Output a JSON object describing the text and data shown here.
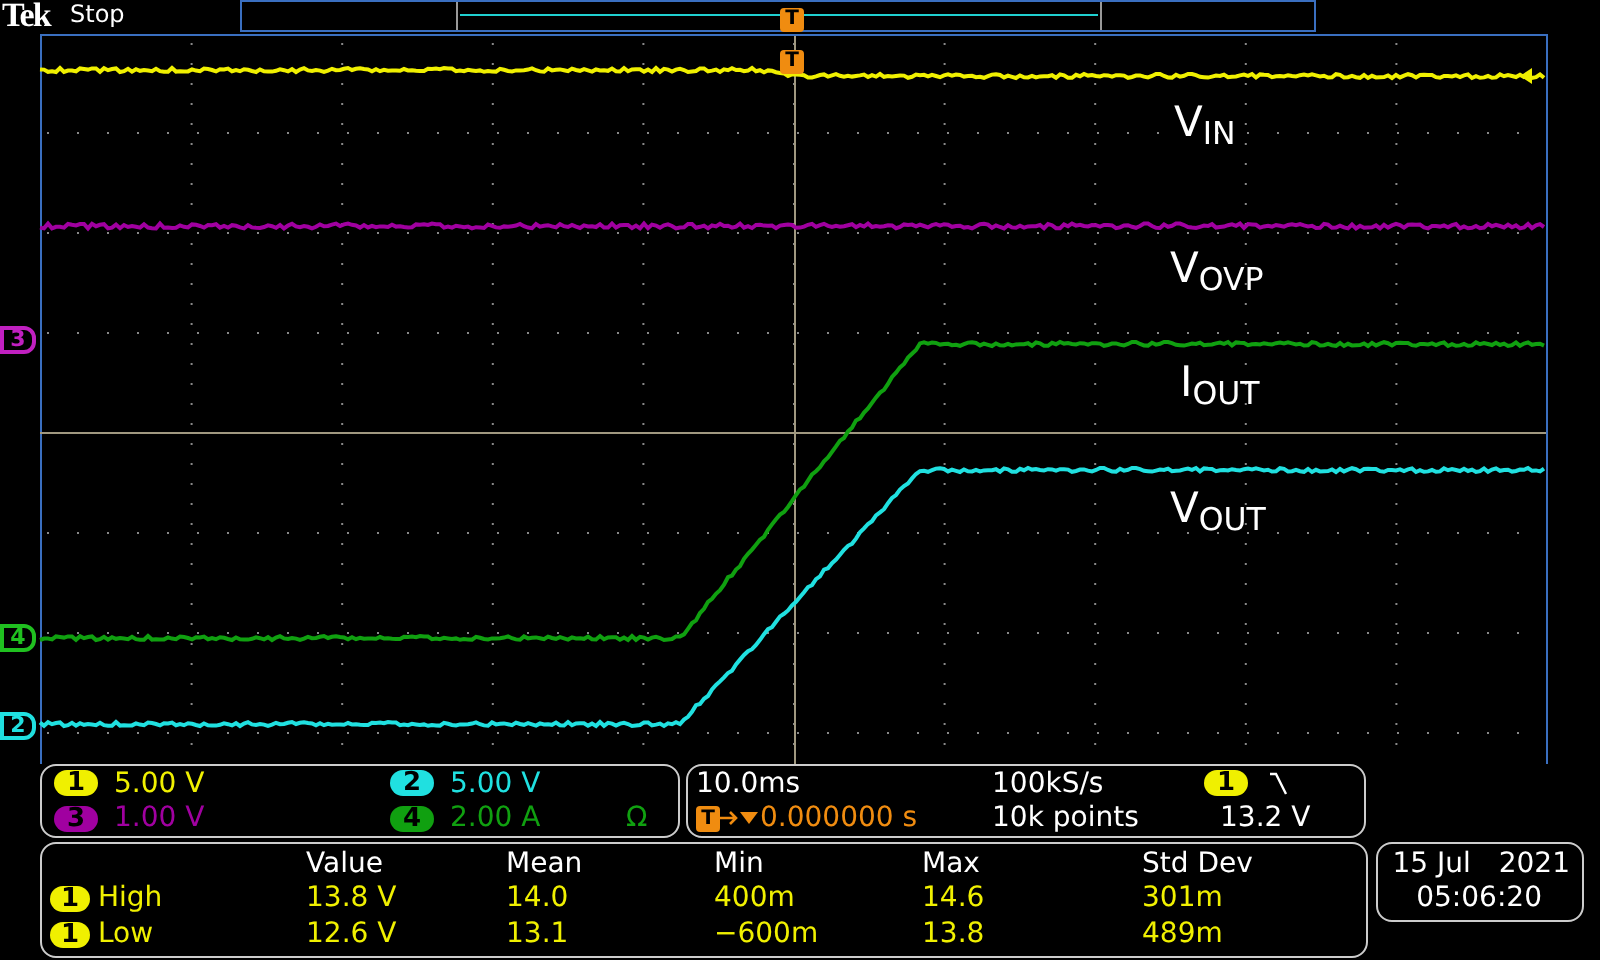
{
  "brand": "Tek",
  "acquisition_status": "Stop",
  "record_view": {
    "trigger_marker": "T"
  },
  "graticule": {
    "trigger_marker": "T"
  },
  "left_markers": [
    {
      "label": "3",
      "color": "#c020c0"
    },
    {
      "label": "4",
      "color": "#20c020"
    },
    {
      "label": "2",
      "color": "#20e0e0"
    }
  ],
  "trace_labels": [
    "V$_{IN}$",
    "V$_{OVP}$",
    "I$_{OUT}$",
    "V$_{OUT}$"
  ],
  "channels": [
    {
      "number": "1",
      "scale": "5.00 V",
      "color": "#f0f000"
    },
    {
      "number": "2",
      "scale": "5.00 V",
      "color": "#20e0e0"
    },
    {
      "number": "3",
      "scale": "1.00 V",
      "color": "#a000a0"
    },
    {
      "number": "4",
      "scale": "2.00 A",
      "termination": "Ω",
      "color": "#10a010"
    }
  ],
  "horizontal": {
    "time_scale": "10.0ms",
    "trigger_marker": "T",
    "trigger_position": "0.000000 s",
    "sample_rate": "100kS/s",
    "record_length": "10k points",
    "trigger_source": {
      "label": "1",
      "color": "#f0f000"
    },
    "trigger_level": "13.2 V"
  },
  "measurements": {
    "columns": [
      "Value",
      "Mean",
      "Min",
      "Max",
      "Std Dev"
    ],
    "rows": [
      {
        "source": "1",
        "color": "#f0f000",
        "name": "High",
        "values": [
          "13.8 V",
          "14.0",
          "400m",
          "14.6",
          "301m"
        ]
      },
      {
        "source": "1",
        "color": "#f0f000",
        "name": "Low",
        "values": [
          "12.6 V",
          "13.1",
          "−600m",
          "13.8",
          "489m"
        ]
      }
    ]
  },
  "date": {
    "day_month": "15 Jul",
    "year": "2021",
    "time": "05:06:20"
  }
}
